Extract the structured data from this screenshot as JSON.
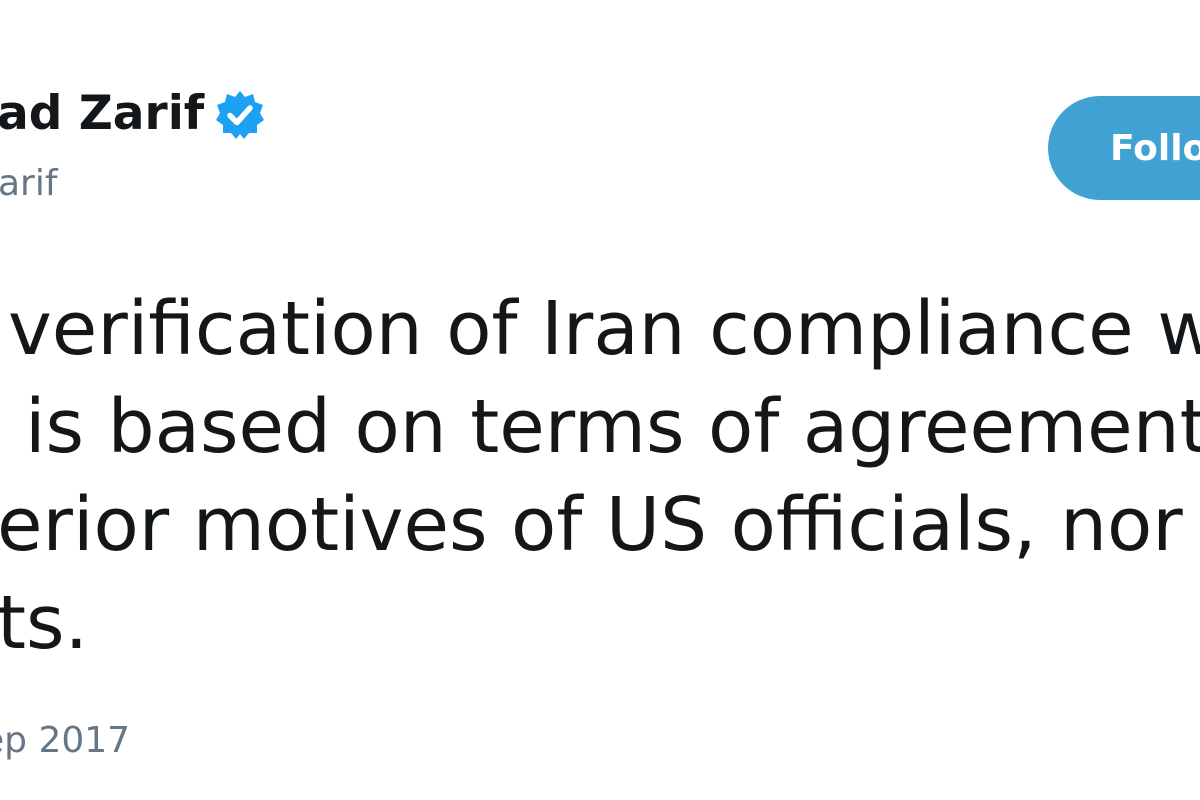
{
  "tweet": {
    "author": {
      "display_name": "ad Zarif",
      "handle": "arif",
      "verified_icon": "verified-badge-icon"
    },
    "follow_label": "Follo",
    "text_lines": [
      "verification of Iran compliance w",
      "is based on terms of agreement",
      "erior motives of US officials, nor",
      "ts."
    ],
    "timestamp": "ep 2017"
  },
  "colors": {
    "follow_button": "#40a1d3",
    "verified_badge": "#1da1f2",
    "text": "#14171a",
    "secondary_text": "#657786"
  }
}
